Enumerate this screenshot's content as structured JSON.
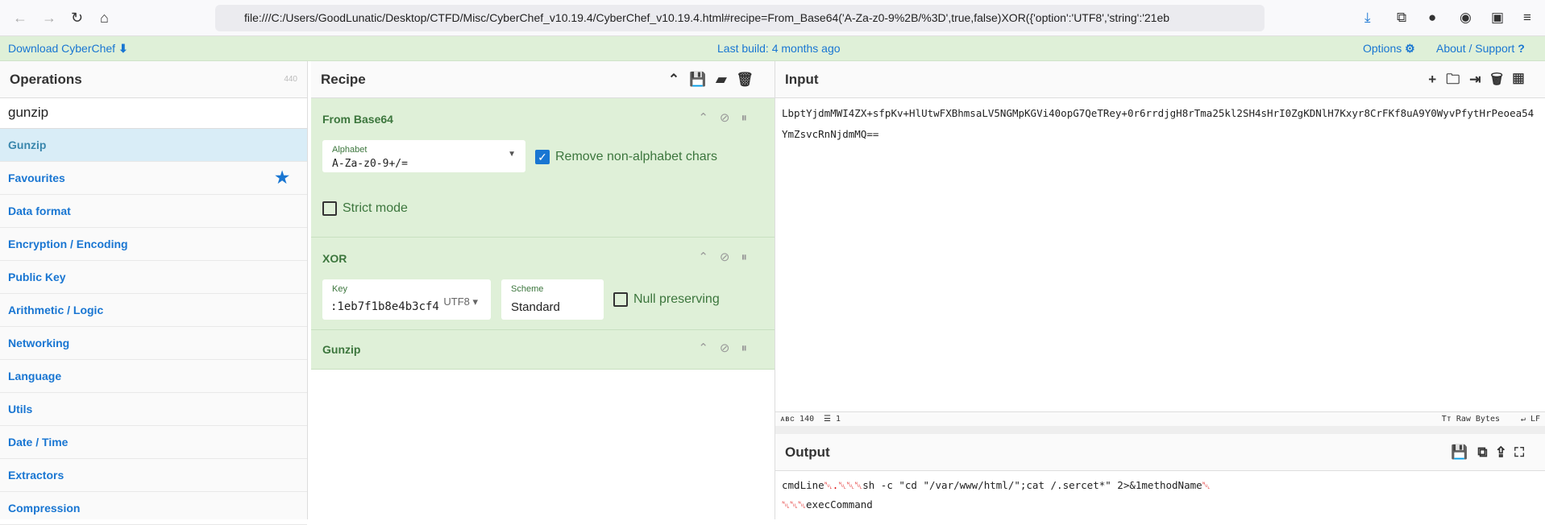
{
  "browser": {
    "url": "file:///C:/Users/GoodLunatic/Desktop/CTFD/Misc/CyberChef_v10.19.4/CyberChef_v10.19.4.html#recipe=From_Base64('A-Za-z0-9%2B/%3D',true,false)XOR({'option':'UTF8','string':'21eb"
  },
  "banner": {
    "download": "Download CyberChef",
    "build": "Last build: 4 months ago",
    "options": "Options",
    "about": "About / Support"
  },
  "operations": {
    "title": "Operations",
    "count": "440",
    "search": "gunzip",
    "items": [
      {
        "label": "Gunzip"
      },
      {
        "label": "Favourites"
      },
      {
        "label": "Data format"
      },
      {
        "label": "Encryption / Encoding"
      },
      {
        "label": "Public Key"
      },
      {
        "label": "Arithmetic / Logic"
      },
      {
        "label": "Networking"
      },
      {
        "label": "Language"
      },
      {
        "label": "Utils"
      },
      {
        "label": "Date / Time"
      },
      {
        "label": "Extractors"
      },
      {
        "label": "Compression"
      }
    ]
  },
  "recipe": {
    "title": "Recipe",
    "ops": [
      {
        "name": "From Base64",
        "alphabet_label": "Alphabet",
        "alphabet": "A-Za-z0-9+/=",
        "remove_label": "Remove non-alphabet chars",
        "remove": true,
        "strict_label": "Strict mode",
        "strict": false
      },
      {
        "name": "XOR",
        "key_label": "Key",
        "key": ":1eb7f1b8e4b3cf4",
        "key_format": "UTF8",
        "scheme_label": "Scheme",
        "scheme": "Standard",
        "null_label": "Null preserving",
        "null": false
      },
      {
        "name": "Gunzip"
      }
    ]
  },
  "input": {
    "title": "Input",
    "text": "LbptYjdmMWI4ZX+sfpKv+HlUtwFXBhmsaLV5NGMpKGVi40opG7QeTRey+0r6rrdjgH8rTma25kl2SH4sHrI0ZgKDNlH7Kxyr8CrFKf8uA9Y0WyvPfytHrPeoea54YmZsvcRnNjdmMQ==",
    "length": "140",
    "lines": "1",
    "encoding": "Raw Bytes",
    "eol": "LF"
  },
  "output": {
    "title": "Output",
    "line1a": "cmdLine",
    "ctrl1": "␀.␀␀␀",
    "line1b": "sh -c \"cd \"/var/www/html/\";cat /.sercet*\" 2>&1methodName",
    "ctrl2": "␀",
    "ctrl3": "␀␀␀",
    "line2": "execCommand"
  },
  "colors": {
    "accent": "#1976d2",
    "op_bg": "#dff0d8",
    "op_text": "#3c763d"
  }
}
